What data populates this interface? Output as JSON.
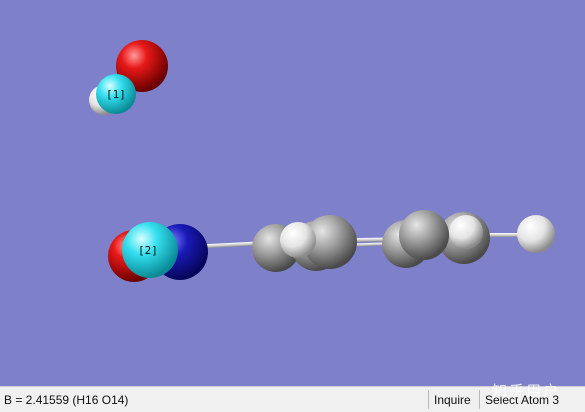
{
  "viewport": {
    "background_color": "#7e80c9",
    "atom_labels": [
      "[1]",
      "[2]"
    ],
    "atom_colors": {
      "oxygen": "#e01010",
      "hydrogen": "#e8e8e8",
      "nitrogen": "#1a1aa8",
      "carbon": "#9a9a9a",
      "selected": "#34e0f0"
    }
  },
  "status_bar": {
    "measurement": "B = 2.41559 (H16 O14)",
    "mode": "Inquire",
    "prompt": "Select Atom 3"
  },
  "watermark": {
    "text": "知乎用户"
  }
}
